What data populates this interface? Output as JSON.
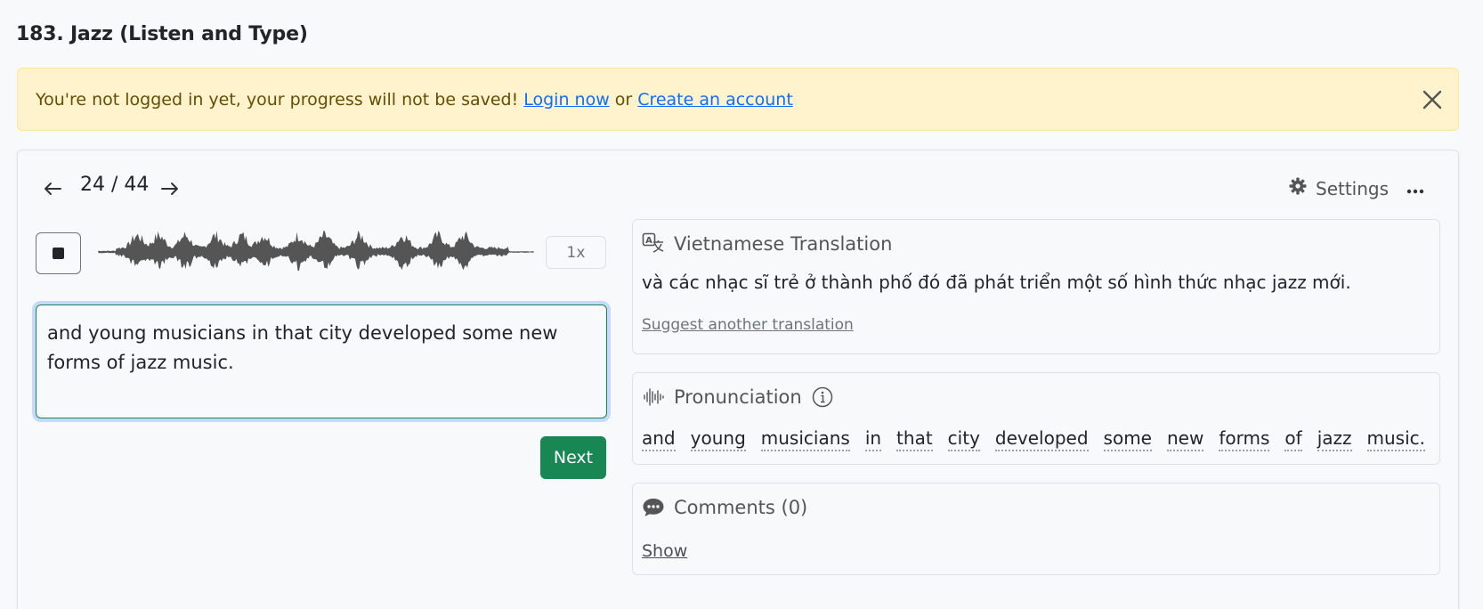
{
  "page": {
    "title": "183. Jazz (Listen and Type)"
  },
  "alert": {
    "message": "You're not logged in yet, your progress will not be saved!",
    "login_link": "Login now",
    "separator": "or",
    "create_link": "Create an account",
    "close_icon": "close-icon"
  },
  "player": {
    "prev_icon": "arrow-left-icon",
    "next_icon": "arrow-right-icon",
    "counter": "24 / 44",
    "settings_label": "Settings",
    "settings_icon": "gear-icon",
    "more_icon": "ellipsis-icon",
    "stop_icon": "stop-icon",
    "speed_label": "1x"
  },
  "answer": {
    "value": "and young musicians in that city developed some new forms of jazz music.",
    "next_label": "Next"
  },
  "translation": {
    "heading": "Vietnamese Translation",
    "icon": "translate-icon",
    "text": "và các nhạc sĩ trẻ ở thành phố đó đã phát triển một số hình thức nhạc jazz mới.",
    "suggest_link": "Suggest another translation"
  },
  "pronunciation": {
    "heading": "Pronunciation",
    "icon": "soundwave-icon",
    "info_icon": "info-icon",
    "words": [
      "and",
      "young",
      "musicians",
      "in",
      "that",
      "city",
      "developed",
      "some",
      "new",
      "forms",
      "of",
      "jazz",
      "music."
    ]
  },
  "comments": {
    "heading": "Comments (0)",
    "icon": "chat-icon",
    "show_link": "Show"
  },
  "colors": {
    "alert_bg": "#fff3cd",
    "alert_text": "#664d03",
    "link": "#0d6efd",
    "success": "#198754",
    "waveform": "#555555"
  }
}
